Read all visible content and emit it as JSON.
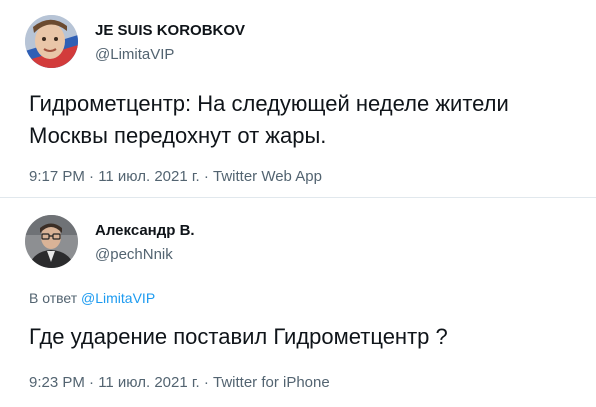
{
  "tweets": [
    {
      "author": {
        "name": "JE SUIS KOROBKOV",
        "handle": "@LimitaVIP",
        "avatar_icon": "avatar-photo-icon"
      },
      "text": "Гидрометцентр: На следующей неделе жители Москвы передохнут от жары.",
      "meta": "9:17 PM · 11 июл. 2021 г. · Twitter Web App"
    },
    {
      "author": {
        "name": "Александр В.",
        "handle": "@pechNnik",
        "avatar_icon": "avatar-photo-icon"
      },
      "reply_to": {
        "prefix": "В ответ",
        "handle": "@LimitaVIP"
      },
      "text": "Где ударение поставил Гидрометцентр ?",
      "meta": "9:23 PM · 11 июл. 2021 г. · Twitter for iPhone"
    }
  ],
  "colors": {
    "link": "#1d9bf0",
    "secondary_text": "#536471",
    "primary_text": "#0f1419",
    "divider": "#e1e8ed"
  }
}
